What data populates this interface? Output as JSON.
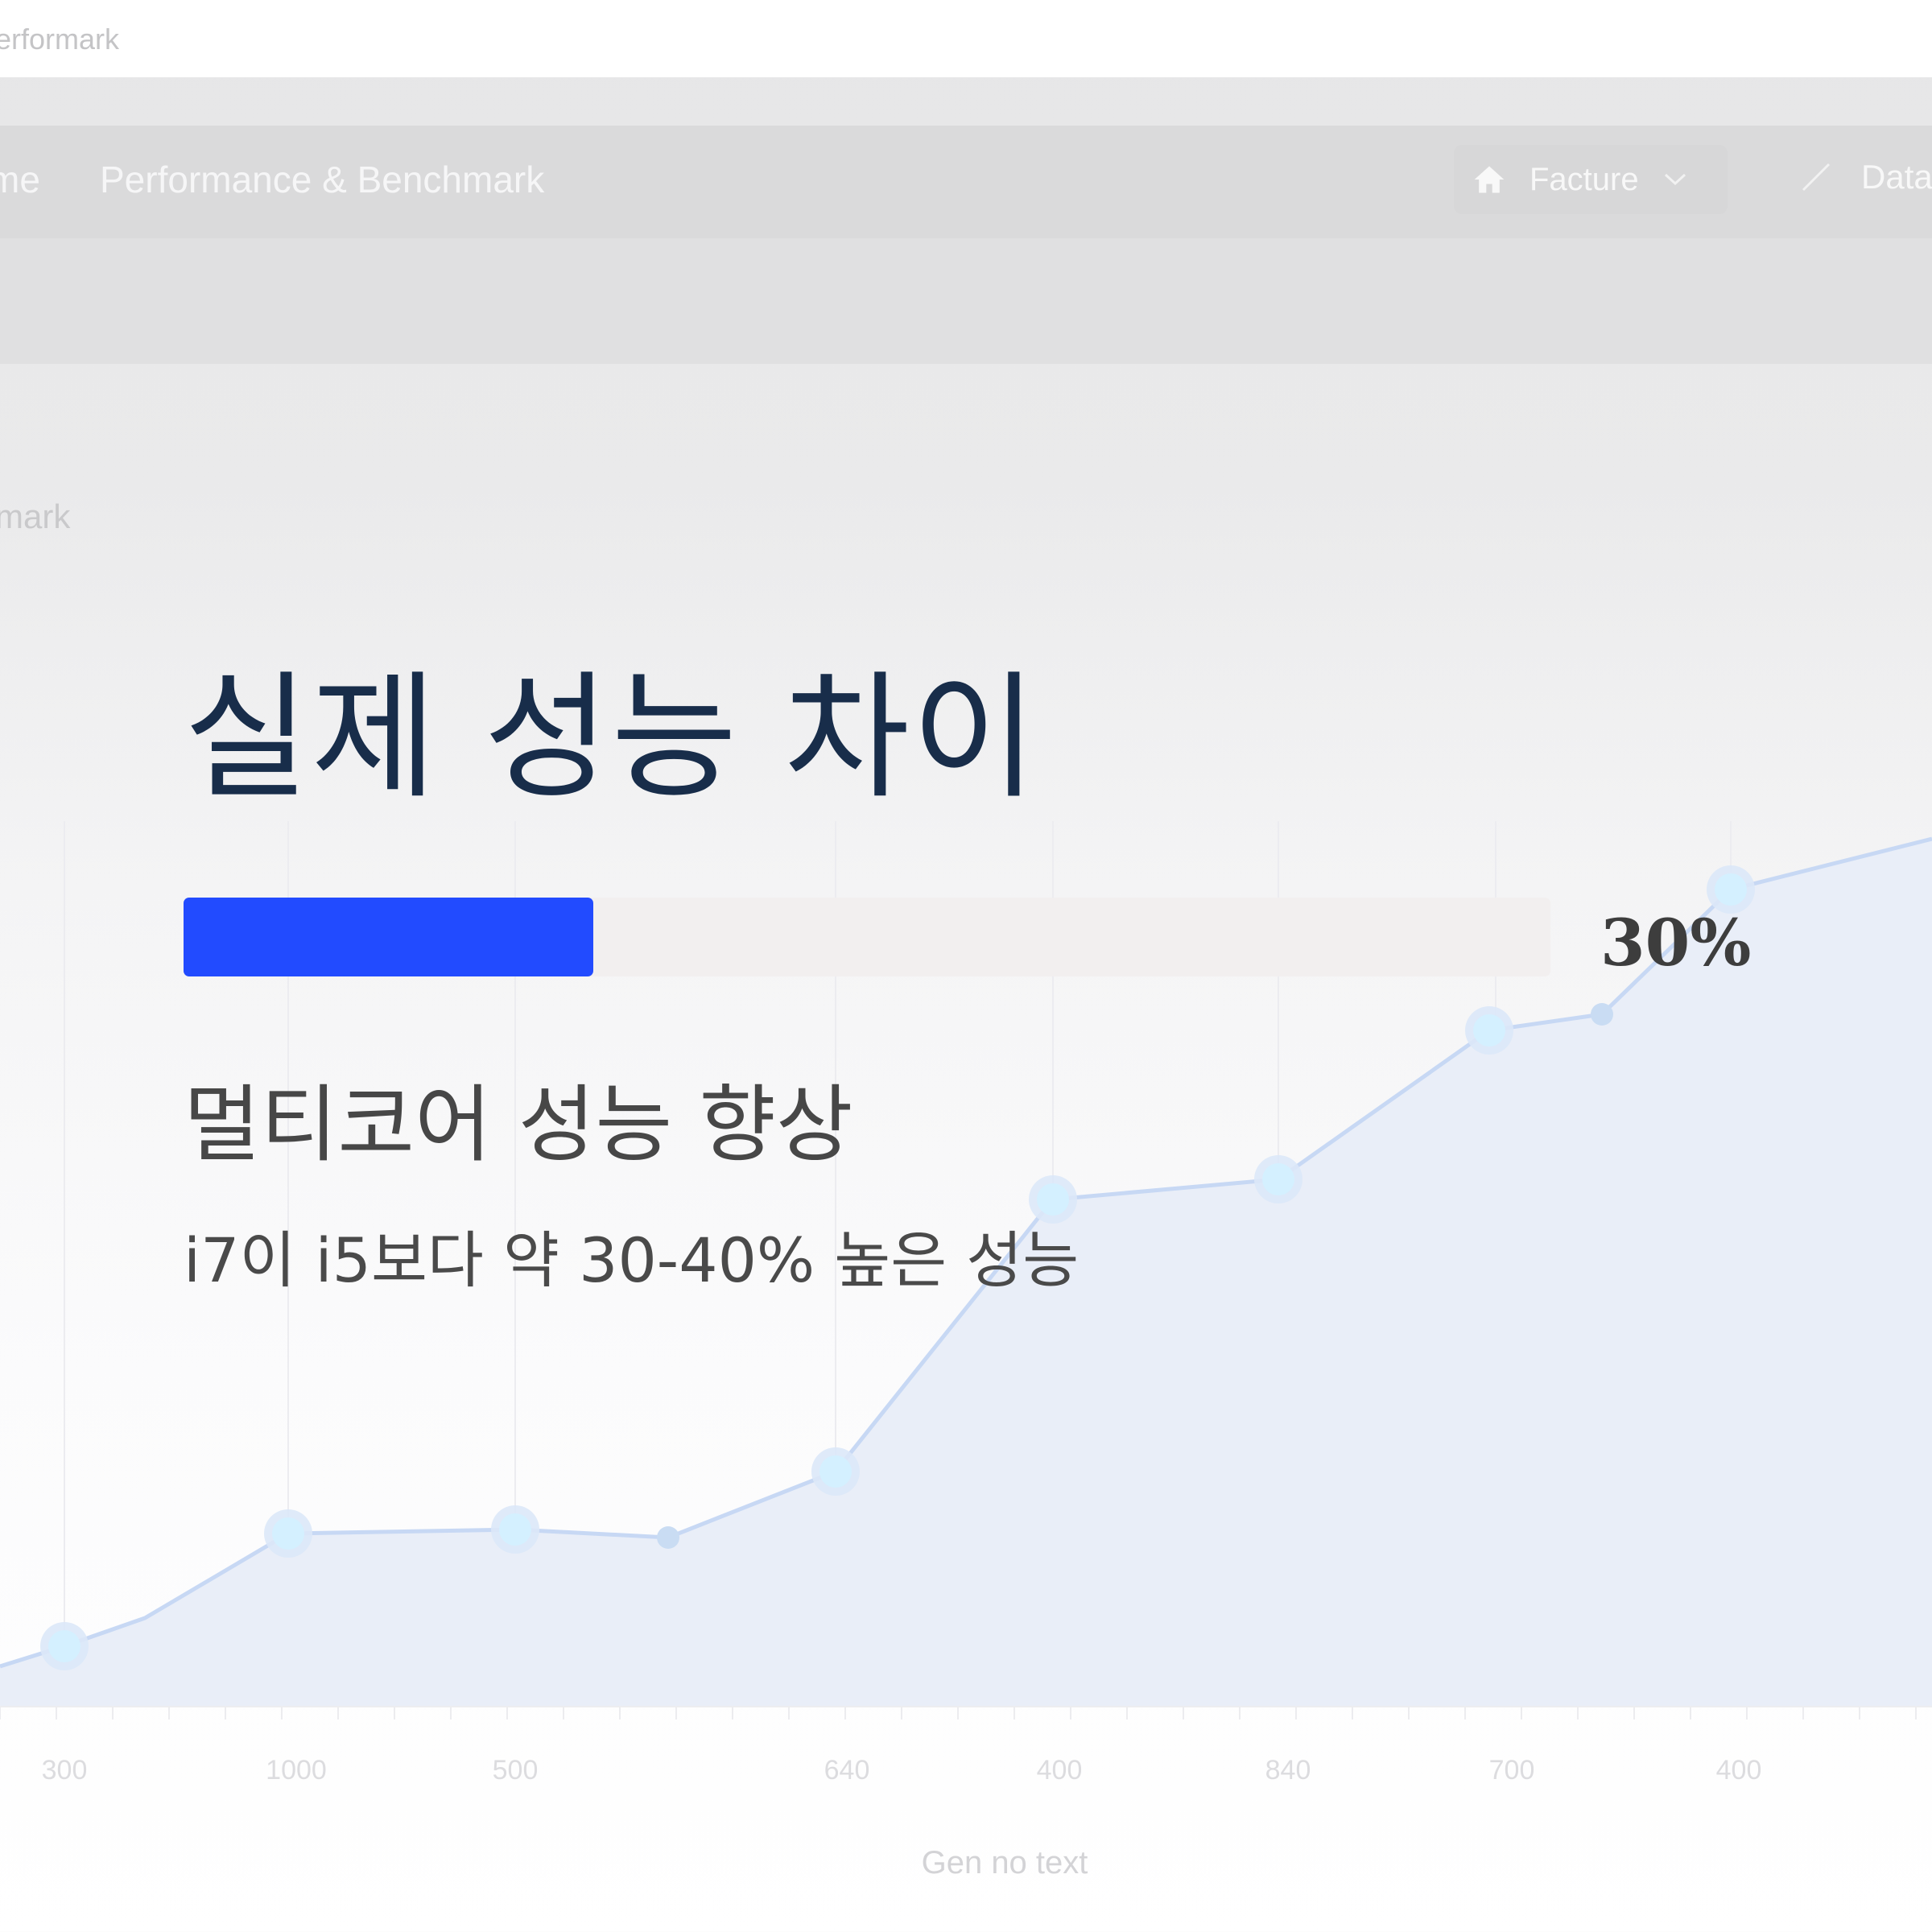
{
  "window": {
    "title": "erformark"
  },
  "nav": {
    "home_label": "me",
    "title": "Performance & Benchmark",
    "facture_label": "Facture",
    "data_label": "Data"
  },
  "breadcrumb": "mark",
  "main": {
    "heading": "실제 성능 차이",
    "progress": {
      "fraction": 0.3,
      "label": "30%"
    },
    "subtitle": "멀티코어 성능 향상",
    "description": "i7이 i5보다 약 30-40% 높은 성능"
  },
  "chart_data": {
    "type": "area",
    "categories": [
      "300",
      "1000",
      "500",
      "640",
      "400",
      "840",
      "700",
      "400"
    ],
    "xlabel": "Gen no text",
    "colors": {
      "line": "#c7d8f4",
      "fill": "#e9eef8",
      "marker": "#d4f0ff"
    }
  },
  "icons": {
    "facture": "home-icon",
    "facture_dropdown": "chevron-down-icon",
    "data": "slash-icon"
  }
}
